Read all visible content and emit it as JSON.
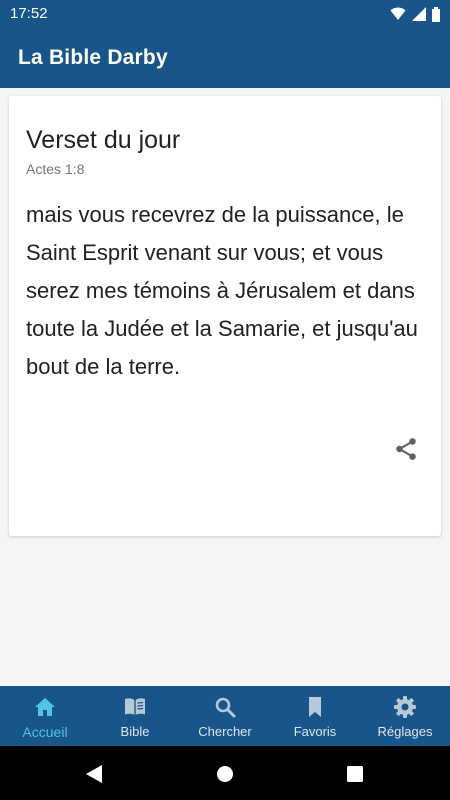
{
  "status_bar": {
    "time": "17:52",
    "icons": [
      "wifi-icon",
      "signal-icon",
      "battery-icon"
    ]
  },
  "app_bar": {
    "title": "La Bible Darby"
  },
  "verse_card": {
    "title": "Verset du jour",
    "reference": "Actes 1:8",
    "text": "mais vous recevrez de la puissance, le Saint Esprit venant sur vous; et vous serez mes témoins à Jérusalem et dans toute la Judée et la Samarie, et jusqu'au bout de la terre.",
    "share_icon": "share-icon"
  },
  "bottom_nav": {
    "items": [
      {
        "label": "Accueil",
        "icon": "home-icon",
        "active": true
      },
      {
        "label": "Bible",
        "icon": "book-icon",
        "active": false
      },
      {
        "label": "Chercher",
        "icon": "search-icon",
        "active": false
      },
      {
        "label": "Favoris",
        "icon": "bookmark-icon",
        "active": false
      },
      {
        "label": "Réglages",
        "icon": "gear-icon",
        "active": false
      }
    ]
  },
  "system_nav": {
    "buttons": [
      "back-icon",
      "home-circle-icon",
      "recents-icon"
    ]
  },
  "colors": {
    "primary": "#17558a",
    "accent": "#52c3e6",
    "background": "#f5f5f5"
  }
}
